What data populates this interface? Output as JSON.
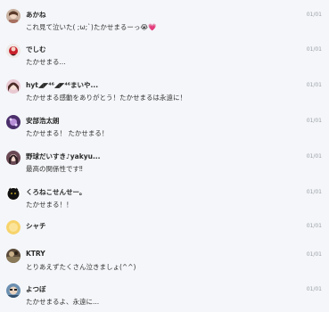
{
  "conversations": [
    {
      "name": "あかね",
      "message": "これ見て泣いた( ;ω;`)たかせまるーっ😭💗",
      "date": "01/01",
      "avatar": "photo-avatar-icon"
    },
    {
      "name": "でしむ",
      "message": "たかせまる...",
      "date": "01/01",
      "avatar": "photo-avatar-icon"
    },
    {
      "name": "hyt◢◤⁴⁶◢◤⁴⁶まいや...",
      "message": "たかせまる感動をありがとう！たかせまるは永遠に！",
      "date": "01/01",
      "avatar": "photo-avatar-icon"
    },
    {
      "name": "安部浩太朗",
      "message": "たかせまる！ たかせまる！",
      "date": "01/01",
      "avatar": "photo-avatar-icon"
    },
    {
      "name": "野球だいすき♪yakyu...",
      "message": "最高の関係性です‼",
      "date": "01/01",
      "avatar": "photo-avatar-icon"
    },
    {
      "name": "くろねこせんせー。",
      "message": "たかせまる！！",
      "date": "01/01",
      "avatar": "black-cat-avatar-icon"
    },
    {
      "name": "シャチ",
      "message": "",
      "date": "01/01",
      "avatar": "yellow-avatar-icon"
    },
    {
      "name": "KTRY",
      "message": "とりあえずたくさん泣きましょ(^^)",
      "date": "01/01",
      "avatar": "photo-avatar-icon"
    },
    {
      "name": "よつぼ",
      "message": "たかせまるよ、永遠に...",
      "date": "01/01",
      "avatar": "photo-avatar-icon"
    }
  ]
}
